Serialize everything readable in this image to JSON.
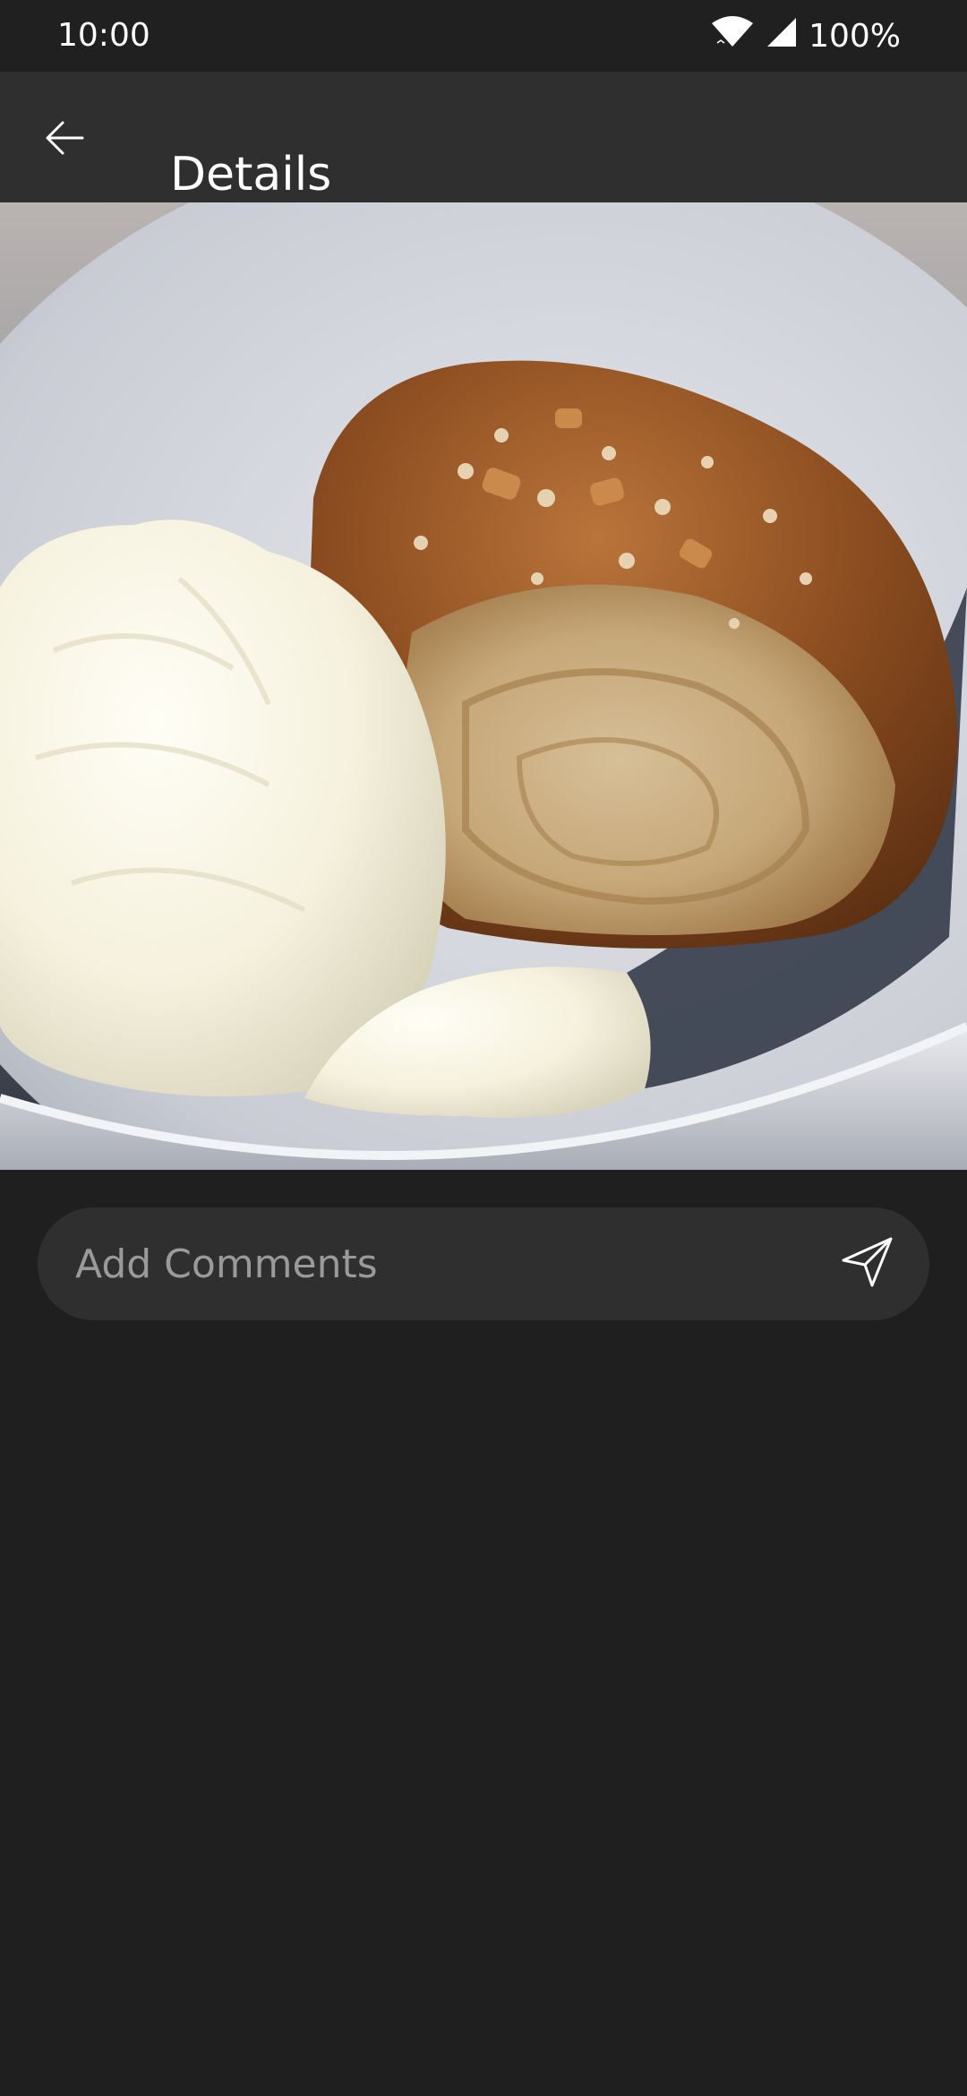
{
  "status_bar": {
    "time": "10:00",
    "battery": "100%",
    "icons": [
      "wifi-icon",
      "signal-icon"
    ]
  },
  "app_bar": {
    "title": "Details",
    "back_icon": "arrow-left-icon"
  },
  "photo": {
    "alt": "Pastry with scoop of vanilla ice cream in a bowl"
  },
  "comments": {
    "placeholder": "Add Comments",
    "value": "",
    "send_icon": "send-icon"
  },
  "colors": {
    "background": "#1f1f1f",
    "status_bar": "#202020",
    "app_bar": "#2f2f2f",
    "input_bg": "#2f2f2f",
    "placeholder": "#9a9a9a"
  }
}
